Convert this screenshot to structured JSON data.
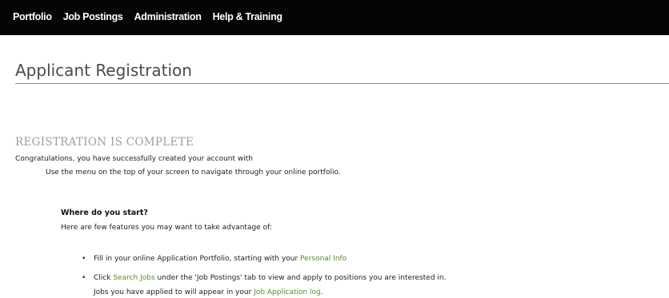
{
  "nav": {
    "items": [
      "Portfolio",
      "Job Postings",
      "Administration",
      "Help & Training"
    ]
  },
  "page": {
    "title": "Applicant Registration"
  },
  "registration": {
    "heading": "REGISTRATION IS COMPLETE",
    "congrats": "Congratulations, you have successfully created your account with",
    "use_menu": "Use the menu on the top of your screen to navigate through your online portfolio.",
    "where_start": "Where do you start?",
    "features_intro": "Here are few features you may want to take advantage of:"
  },
  "bullets": {
    "bullet_char": "•",
    "item1_pre": "Fill in your online Application Portfolio, starting with your ",
    "item1_link": "Personal Info",
    "item2_pre": "Click ",
    "item2_link": "Search Jobs",
    "item2_post": " under the 'Job Postings' tab to view and apply to positions you are interested in.",
    "item2b_pre": "Jobs you have applied to will appear in your ",
    "item2b_link": "Job Application log",
    "item2b_post": "."
  },
  "colors": {
    "nav_bg": "#050505",
    "link": "#5c8a2e",
    "heading_gray": "#9e9e9e"
  }
}
